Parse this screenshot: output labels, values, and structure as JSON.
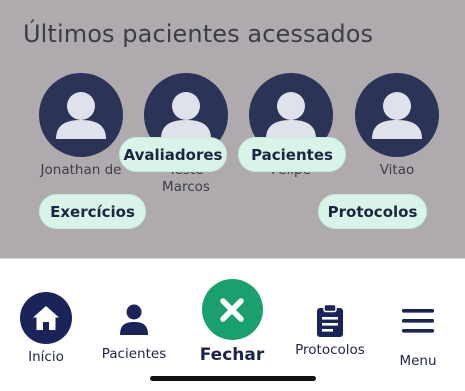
{
  "recent": {
    "title": "Últimos pacientes acessados",
    "patients": [
      {
        "name": "Jonathan de"
      },
      {
        "name": "Teste Marcos"
      },
      {
        "name": "Felipe"
      },
      {
        "name": "Vitao"
      }
    ]
  },
  "quick_menu": {
    "evaluators": "Avaliadores",
    "patients": "Pacientes",
    "exercises": "Exercícios",
    "protocols": "Protocolos"
  },
  "tabbar": {
    "home": "Início",
    "patients": "Pacientes",
    "close": "Fechar",
    "protocols": "Protocolos",
    "menu": "Menu"
  },
  "colors": {
    "navy": "#1a2459",
    "avatar": "#2b3357",
    "green": "#19a06d",
    "pill": "#d8f4e9",
    "overlay": "#aeaaad"
  },
  "icons": {
    "home": "home-icon",
    "person": "person-icon",
    "close": "close-icon",
    "clipboard": "clipboard-icon",
    "menu": "hamburger-menu-icon"
  }
}
